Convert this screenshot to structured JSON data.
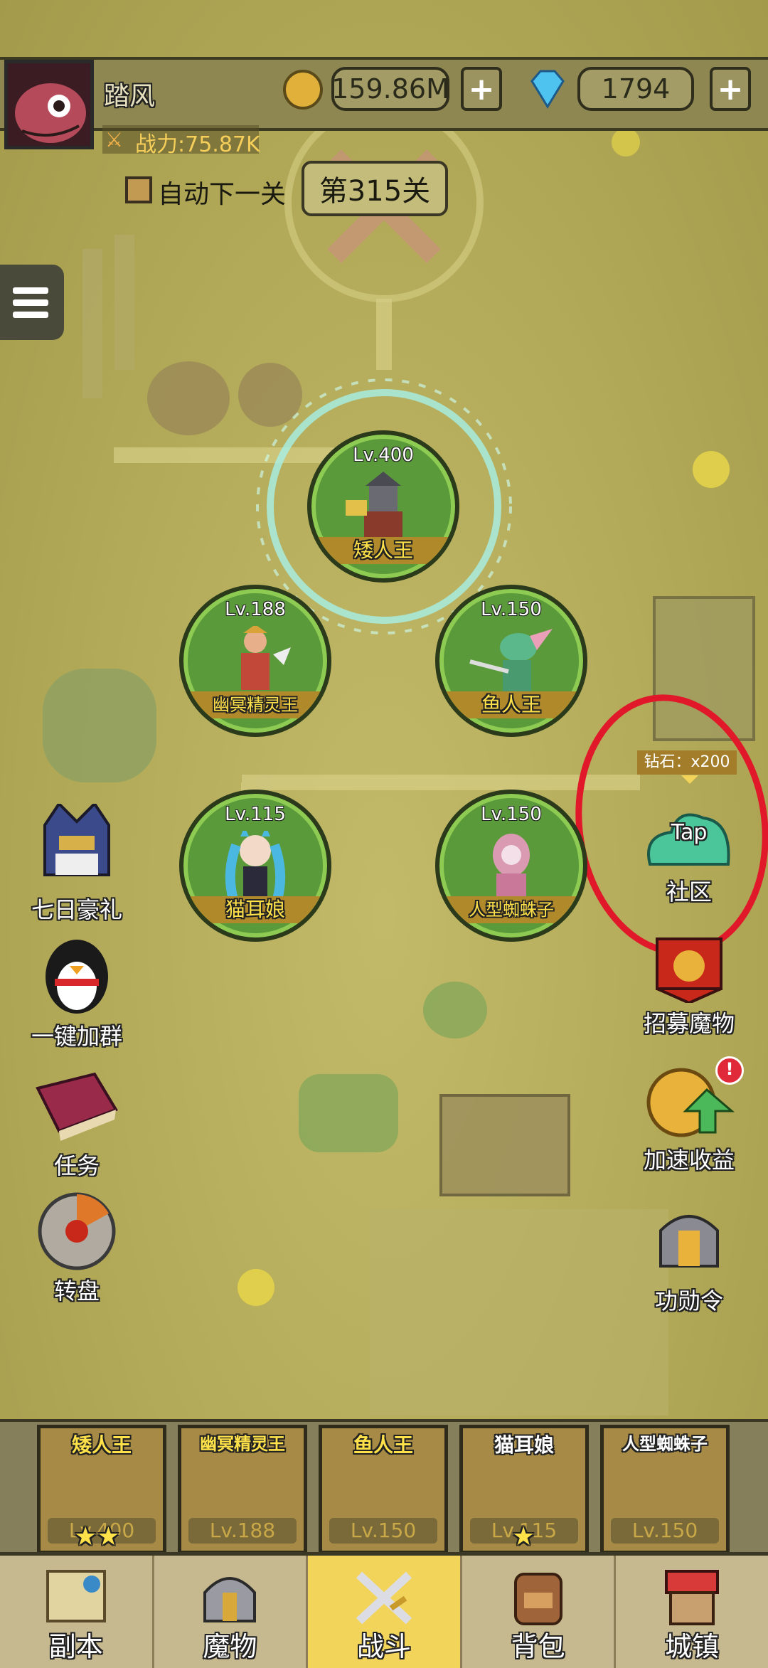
{
  "player": {
    "name": "踏风",
    "power": "战力:75.87K"
  },
  "currency": {
    "gold": "159.86M",
    "diamonds": "1794",
    "plus": "+"
  },
  "stage": {
    "auto_next_label": "自动下一关",
    "current": "第315关"
  },
  "monsters": [
    {
      "level": "Lv.400",
      "name": "矮人王"
    },
    {
      "level": "Lv.188",
      "name": "幽冥精灵王"
    },
    {
      "level": "Lv.150",
      "name": "鱼人王"
    },
    {
      "level": "Lv.115",
      "name": "猫耳娘"
    },
    {
      "level": "Lv.150",
      "name": "人型蜘蛛子"
    }
  ],
  "left_buttons": [
    "七日豪礼",
    "一键加群",
    "任务",
    "转盘"
  ],
  "community": {
    "reward": "钻石：x200",
    "tap": "Tap",
    "label": "社区"
  },
  "right_buttons": [
    "招募魔物",
    "加速收益",
    "功勋令"
  ],
  "team": [
    {
      "name": "矮人王",
      "level": "Lv.400"
    },
    {
      "name": "幽冥精灵王",
      "level": "Lv.188"
    },
    {
      "name": "鱼人王",
      "level": "Lv.150"
    },
    {
      "name": "猫耳娘",
      "level": "Lv.115"
    },
    {
      "name": "人型蜘蛛子",
      "level": "Lv.150"
    }
  ],
  "nav": [
    "副本",
    "魔物",
    "战斗",
    "背包",
    "城镇"
  ],
  "colors": {
    "accent_yellow": "#f3d45a",
    "circle_green": "#5a9a3a",
    "annotation_red": "#e0182a"
  }
}
